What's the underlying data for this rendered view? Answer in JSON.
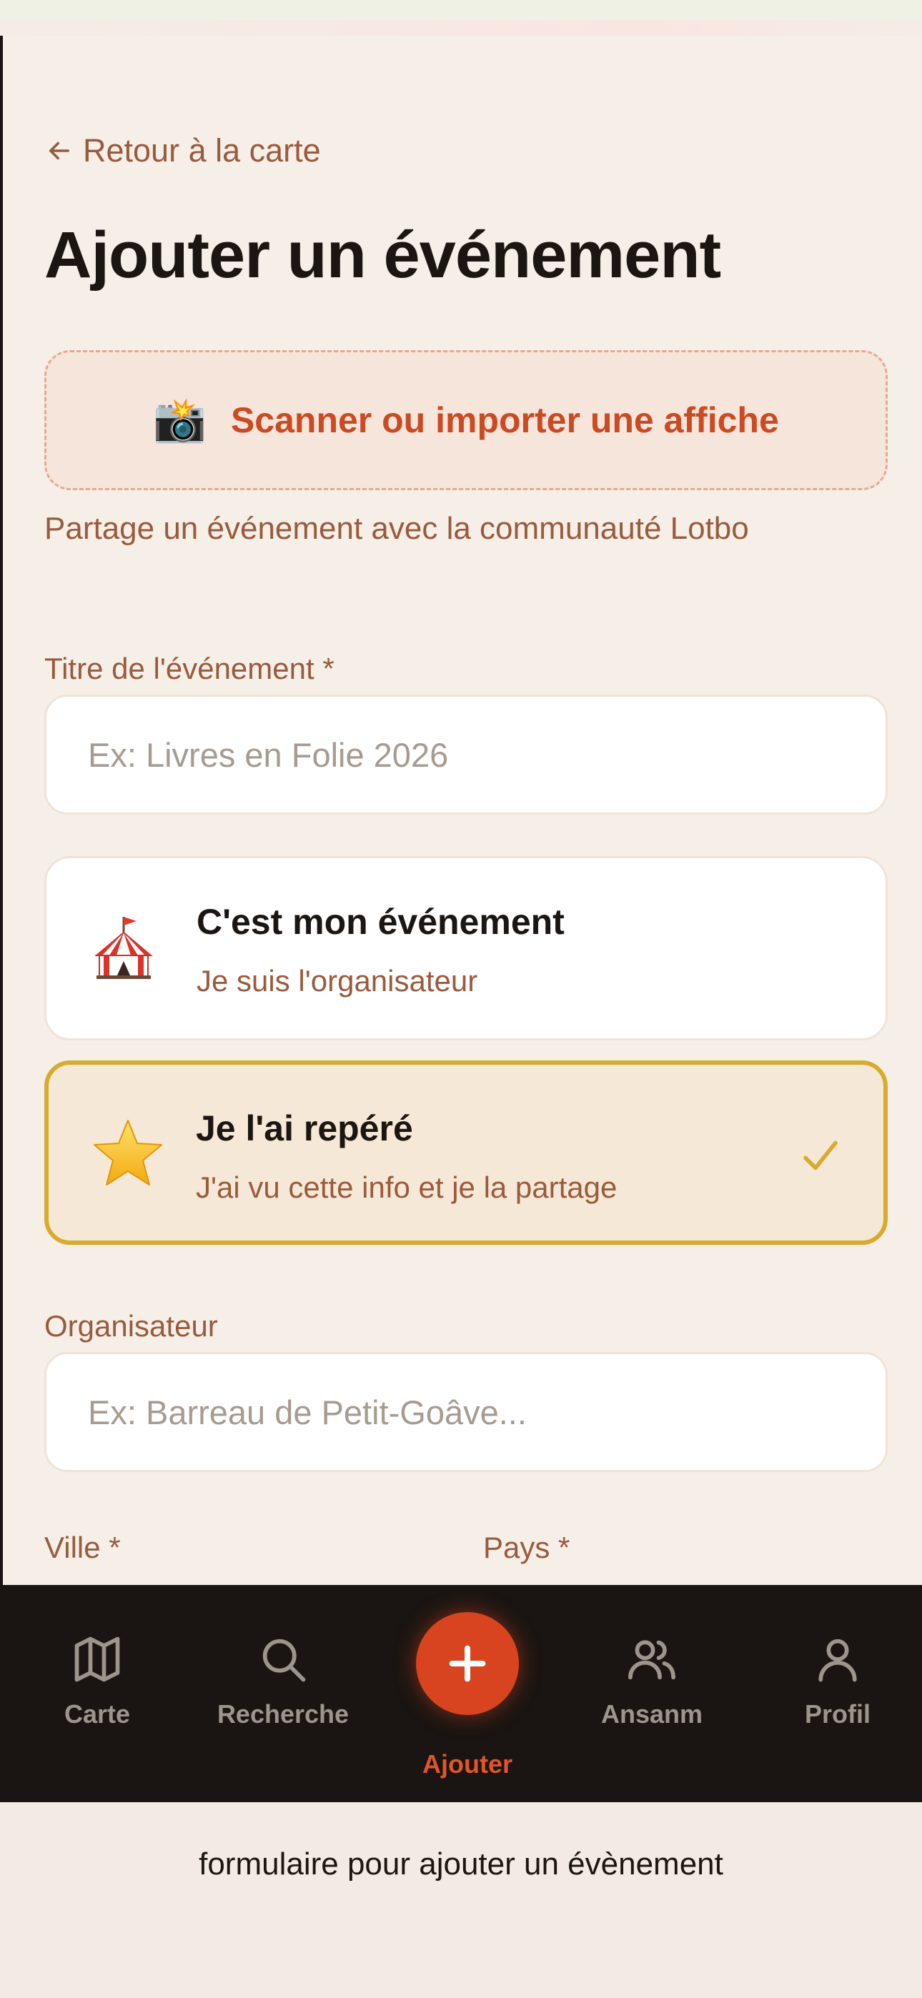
{
  "header": {
    "back_label": "Retour à la carte",
    "title": "Ajouter un événement"
  },
  "scan": {
    "icon": "camera-flash-icon",
    "label": "Scanner ou importer une affiche"
  },
  "subtitle": "Partage un événement avec la communauté Lotbo",
  "form": {
    "title_label": "Titre de l'événement *",
    "title_placeholder": "Ex: Livres en Folie 2026",
    "title_value": "",
    "organizer_label": "Organisateur",
    "organizer_placeholder": "Ex: Barreau de Petit-Goâve...",
    "organizer_value": "",
    "city_label": "Ville *",
    "country_label": "Pays *"
  },
  "choices": [
    {
      "icon": "circus-tent-icon",
      "title": "C'est mon événement",
      "desc": "Je suis l'organisateur",
      "selected": false
    },
    {
      "icon": "star-icon",
      "title": "Je l'ai repéré",
      "desc": "J'ai vu cette info et je la partage",
      "selected": true
    }
  ],
  "tabbar": {
    "items": [
      {
        "label": "Carte",
        "icon": "map-icon"
      },
      {
        "label": "Recherche",
        "icon": "search-icon"
      },
      {
        "label": "Ajouter",
        "icon": "plus-icon",
        "active": true
      },
      {
        "label": "Ansanm",
        "icon": "users-icon"
      },
      {
        "label": "Profil",
        "icon": "user-icon"
      }
    ]
  },
  "colors": {
    "accent": "#d8441f",
    "selected_border": "#d8aa2e",
    "muted_text": "#9a5a3c",
    "tabbar_bg": "#1a1512"
  },
  "caption": "formulaire pour ajouter un évènement"
}
